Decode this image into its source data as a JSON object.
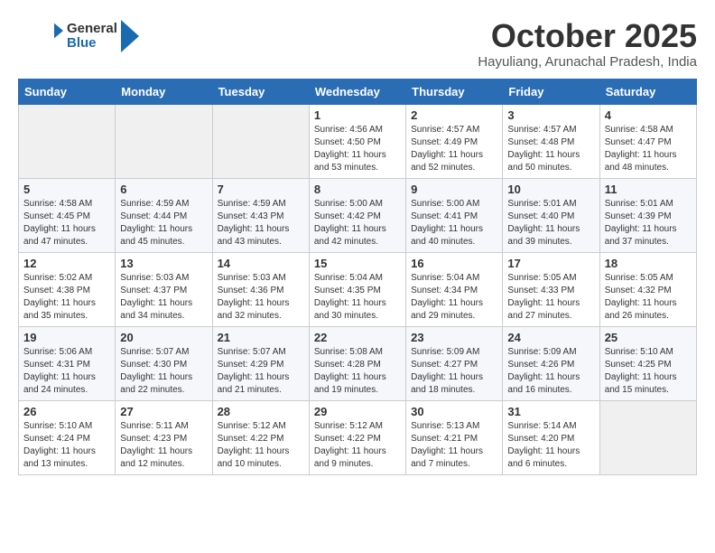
{
  "header": {
    "logo_general": "General",
    "logo_blue": "Blue",
    "month_title": "October 2025",
    "location": "Hayuliang, Arunachal Pradesh, India"
  },
  "days_of_week": [
    "Sunday",
    "Monday",
    "Tuesday",
    "Wednesday",
    "Thursday",
    "Friday",
    "Saturday"
  ],
  "weeks": [
    [
      {
        "day": "",
        "info": ""
      },
      {
        "day": "",
        "info": ""
      },
      {
        "day": "",
        "info": ""
      },
      {
        "day": "1",
        "info": "Sunrise: 4:56 AM\nSunset: 4:50 PM\nDaylight: 11 hours and 53 minutes."
      },
      {
        "day": "2",
        "info": "Sunrise: 4:57 AM\nSunset: 4:49 PM\nDaylight: 11 hours and 52 minutes."
      },
      {
        "day": "3",
        "info": "Sunrise: 4:57 AM\nSunset: 4:48 PM\nDaylight: 11 hours and 50 minutes."
      },
      {
        "day": "4",
        "info": "Sunrise: 4:58 AM\nSunset: 4:47 PM\nDaylight: 11 hours and 48 minutes."
      }
    ],
    [
      {
        "day": "5",
        "info": "Sunrise: 4:58 AM\nSunset: 4:45 PM\nDaylight: 11 hours and 47 minutes."
      },
      {
        "day": "6",
        "info": "Sunrise: 4:59 AM\nSunset: 4:44 PM\nDaylight: 11 hours and 45 minutes."
      },
      {
        "day": "7",
        "info": "Sunrise: 4:59 AM\nSunset: 4:43 PM\nDaylight: 11 hours and 43 minutes."
      },
      {
        "day": "8",
        "info": "Sunrise: 5:00 AM\nSunset: 4:42 PM\nDaylight: 11 hours and 42 minutes."
      },
      {
        "day": "9",
        "info": "Sunrise: 5:00 AM\nSunset: 4:41 PM\nDaylight: 11 hours and 40 minutes."
      },
      {
        "day": "10",
        "info": "Sunrise: 5:01 AM\nSunset: 4:40 PM\nDaylight: 11 hours and 39 minutes."
      },
      {
        "day": "11",
        "info": "Sunrise: 5:01 AM\nSunset: 4:39 PM\nDaylight: 11 hours and 37 minutes."
      }
    ],
    [
      {
        "day": "12",
        "info": "Sunrise: 5:02 AM\nSunset: 4:38 PM\nDaylight: 11 hours and 35 minutes."
      },
      {
        "day": "13",
        "info": "Sunrise: 5:03 AM\nSunset: 4:37 PM\nDaylight: 11 hours and 34 minutes."
      },
      {
        "day": "14",
        "info": "Sunrise: 5:03 AM\nSunset: 4:36 PM\nDaylight: 11 hours and 32 minutes."
      },
      {
        "day": "15",
        "info": "Sunrise: 5:04 AM\nSunset: 4:35 PM\nDaylight: 11 hours and 30 minutes."
      },
      {
        "day": "16",
        "info": "Sunrise: 5:04 AM\nSunset: 4:34 PM\nDaylight: 11 hours and 29 minutes."
      },
      {
        "day": "17",
        "info": "Sunrise: 5:05 AM\nSunset: 4:33 PM\nDaylight: 11 hours and 27 minutes."
      },
      {
        "day": "18",
        "info": "Sunrise: 5:05 AM\nSunset: 4:32 PM\nDaylight: 11 hours and 26 minutes."
      }
    ],
    [
      {
        "day": "19",
        "info": "Sunrise: 5:06 AM\nSunset: 4:31 PM\nDaylight: 11 hours and 24 minutes."
      },
      {
        "day": "20",
        "info": "Sunrise: 5:07 AM\nSunset: 4:30 PM\nDaylight: 11 hours and 22 minutes."
      },
      {
        "day": "21",
        "info": "Sunrise: 5:07 AM\nSunset: 4:29 PM\nDaylight: 11 hours and 21 minutes."
      },
      {
        "day": "22",
        "info": "Sunrise: 5:08 AM\nSunset: 4:28 PM\nDaylight: 11 hours and 19 minutes."
      },
      {
        "day": "23",
        "info": "Sunrise: 5:09 AM\nSunset: 4:27 PM\nDaylight: 11 hours and 18 minutes."
      },
      {
        "day": "24",
        "info": "Sunrise: 5:09 AM\nSunset: 4:26 PM\nDaylight: 11 hours and 16 minutes."
      },
      {
        "day": "25",
        "info": "Sunrise: 5:10 AM\nSunset: 4:25 PM\nDaylight: 11 hours and 15 minutes."
      }
    ],
    [
      {
        "day": "26",
        "info": "Sunrise: 5:10 AM\nSunset: 4:24 PM\nDaylight: 11 hours and 13 minutes."
      },
      {
        "day": "27",
        "info": "Sunrise: 5:11 AM\nSunset: 4:23 PM\nDaylight: 11 hours and 12 minutes."
      },
      {
        "day": "28",
        "info": "Sunrise: 5:12 AM\nSunset: 4:22 PM\nDaylight: 11 hours and 10 minutes."
      },
      {
        "day": "29",
        "info": "Sunrise: 5:12 AM\nSunset: 4:22 PM\nDaylight: 11 hours and 9 minutes."
      },
      {
        "day": "30",
        "info": "Sunrise: 5:13 AM\nSunset: 4:21 PM\nDaylight: 11 hours and 7 minutes."
      },
      {
        "day": "31",
        "info": "Sunrise: 5:14 AM\nSunset: 4:20 PM\nDaylight: 11 hours and 6 minutes."
      },
      {
        "day": "",
        "info": ""
      }
    ]
  ]
}
